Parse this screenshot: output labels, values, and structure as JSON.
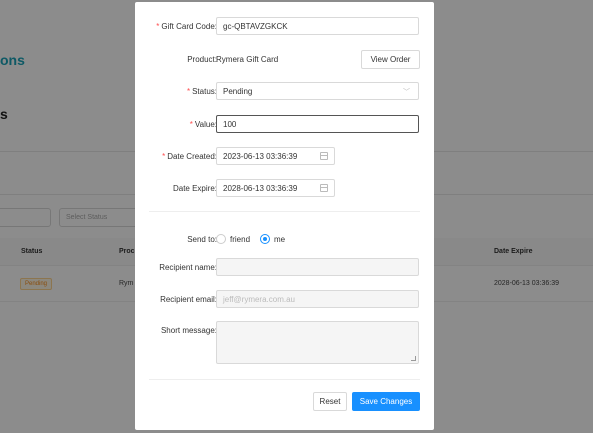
{
  "background": {
    "title_fragment": "ons",
    "subtitle_fragment": "s",
    "filter_placeholder": "Select Status",
    "table": {
      "headers": [
        "Status",
        "Proc",
        "Date Expire"
      ],
      "row": {
        "status": "Pending",
        "product": "Rym",
        "date_expire": "2028-06-13 03:36:39"
      }
    }
  },
  "modal": {
    "gift_card_code": {
      "label": "Gift Card Code:",
      "value": "gc-QBTAVZGKCK"
    },
    "product": {
      "label": "Product:",
      "value": "Rymera Gift Card",
      "button": "View Order"
    },
    "status": {
      "label": "Status:",
      "value": "Pending"
    },
    "value": {
      "label": "Value:",
      "value": "100"
    },
    "date_created": {
      "label": "Date Created:",
      "value": "2023-06-13 03:36:39"
    },
    "date_expire": {
      "label": "Date Expire:",
      "value": "2028-06-13 03:36:39"
    },
    "send_to": {
      "label": "Send to:",
      "options": [
        "friend",
        "me"
      ],
      "selected": "me"
    },
    "recipient_name": {
      "label": "Recipient name:",
      "value": ""
    },
    "recipient_email": {
      "label": "Recipient email:",
      "placeholder": "jeff@rymera.com.au"
    },
    "short_message": {
      "label": "Short message:",
      "value": ""
    },
    "buttons": {
      "reset": "Reset",
      "save": "Save Changes"
    }
  },
  "icons": {
    "calendar": "calendar-icon",
    "chevron": "chevron-down-icon"
  }
}
